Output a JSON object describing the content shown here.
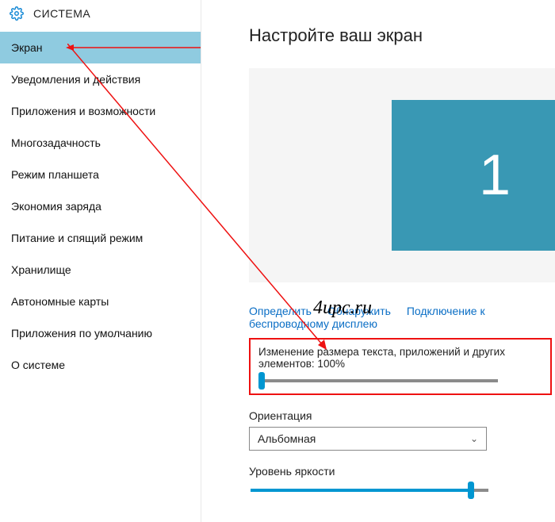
{
  "header": {
    "title": "СИСТЕМА"
  },
  "sidebar": {
    "items": [
      {
        "label": "Экран",
        "selected": true
      },
      {
        "label": "Уведомления и действия"
      },
      {
        "label": "Приложения и возможности"
      },
      {
        "label": "Многозадачность"
      },
      {
        "label": "Режим планшета"
      },
      {
        "label": "Экономия заряда"
      },
      {
        "label": "Питание и спящий режим"
      },
      {
        "label": "Хранилище"
      },
      {
        "label": "Автономные карты"
      },
      {
        "label": "Приложения по умолчанию"
      },
      {
        "label": "О системе"
      }
    ]
  },
  "main": {
    "title": "Настройте ваш экран",
    "display_number": "1",
    "links": {
      "identify": "Определить",
      "detect": "Обнаружить",
      "wireless": "Подключение к беспроводному дисплею"
    },
    "scale": {
      "label": "Изменение размера текста, приложений и других элементов: 100%"
    },
    "orientation": {
      "label": "Ориентация",
      "value": "Альбомная"
    },
    "brightness": {
      "label": "Уровень яркости"
    }
  },
  "watermark": "4upc.ru"
}
